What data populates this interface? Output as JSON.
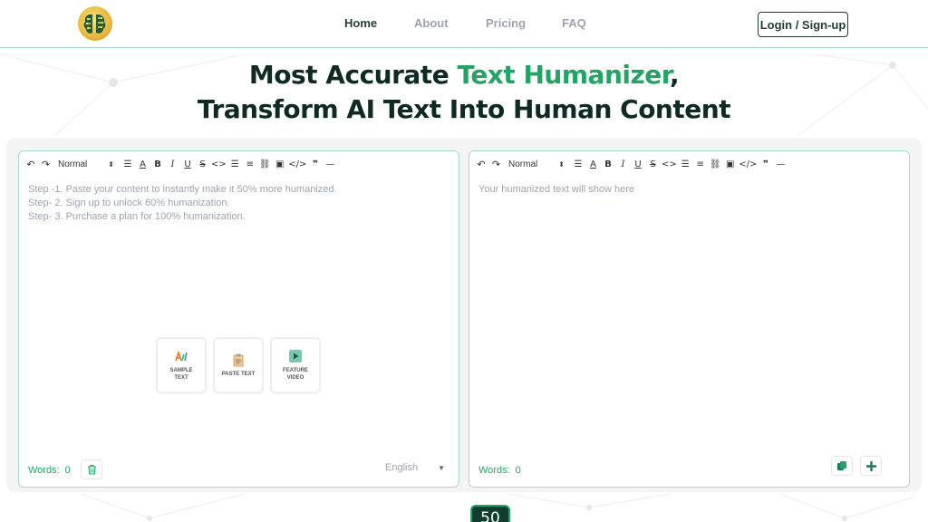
{
  "nav": {
    "items": [
      {
        "label": "Home",
        "active": true
      },
      {
        "label": "About",
        "active": false
      },
      {
        "label": "Pricing",
        "active": false
      },
      {
        "label": "FAQ",
        "active": false
      }
    ],
    "login_label": "Login / Sign-up"
  },
  "hero": {
    "line1_prefix": "Most Accurate ",
    "line1_accent": "Text Humanizer",
    "line1_suffix": ",",
    "line2": "Transform AI Text Into Human Content"
  },
  "input_panel": {
    "format_value": "Normal",
    "steps": [
      "Step -1. Paste your content to instantly make it 50% more humanized.",
      "Step- 2. Sign up to unlock 60% humanization.",
      "Step- 3. Purchase a plan for 100% humanization."
    ],
    "quick_actions": [
      {
        "label": "SAMPLE TEXT",
        "icon": "sample-text-icon"
      },
      {
        "label": "PASTE TEXT",
        "icon": "clipboard-icon"
      },
      {
        "label": "FEATURE VIDEO",
        "icon": "play-icon"
      }
    ],
    "words_label": "Words:",
    "words_count": "0",
    "language": "English"
  },
  "output_panel": {
    "format_value": "Normal",
    "placeholder": "Your humanized text will show here",
    "words_label": "Words:",
    "words_count": "0"
  },
  "score_badge": "50",
  "colors": {
    "accent": "#22a564",
    "dark": "#0f2a22",
    "border": "#a7dcc0"
  }
}
